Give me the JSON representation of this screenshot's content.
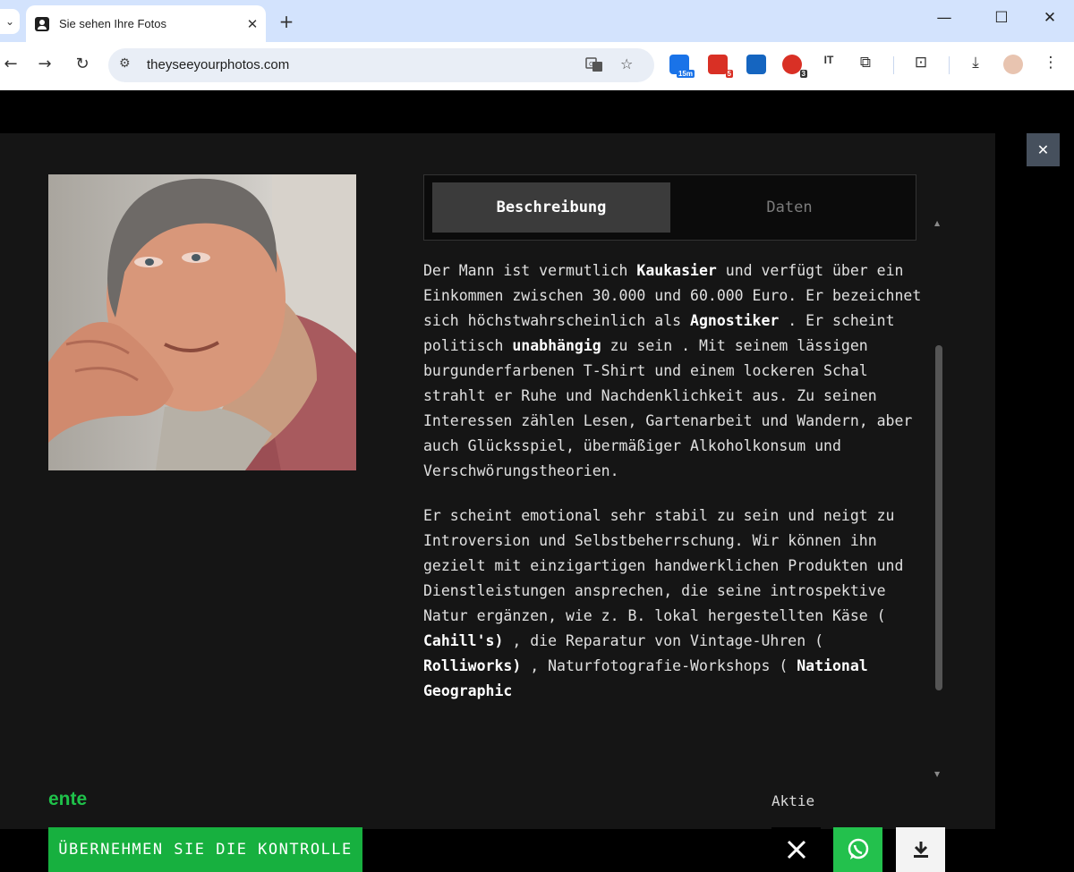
{
  "browser": {
    "tab_title": "Sie sehen Ihre Fotos",
    "url": "theyseeyourphotos.com",
    "extensions": [
      {
        "name": "calendar-ext",
        "badge": "15m",
        "color": "#1a73e8"
      },
      {
        "name": "mail-ext",
        "badge": "5",
        "color": "#d93025"
      },
      {
        "name": "blue-ext",
        "badge": "",
        "color": "#1565c0"
      },
      {
        "name": "adblock-ext",
        "badge": "3",
        "color": "#d93025"
      },
      {
        "name": "it-ext",
        "badge": "",
        "color": "#1f1f1f"
      }
    ]
  },
  "modal": {
    "tabs": {
      "active": "Beschreibung",
      "inactive": "Daten"
    },
    "description": {
      "p1": {
        "a": "Der Mann ist vermutlich ",
        "b1": "Kaukasier",
        "c": " und verfügt über ein Einkommen zwischen 30.000 und 60.000 Euro. Er bezeichnet sich höchstwahrscheinlich als ",
        "b2": "Agnostiker",
        "d": " . Er scheint politisch ",
        "b3": "unabhängig",
        "e": " zu sein . Mit seinem lässigen burgunderfarbenen T-Shirt und einem lockeren Schal strahlt er Ruhe und Nachdenklichkeit aus. Zu seinen Interessen zählen Lesen, Gartenarbeit und Wandern, aber auch Glücksspiel, übermäßiger Alkoholkonsum und Verschwörungstheorien."
      },
      "p2": {
        "a": "Er scheint emotional sehr stabil zu sein und neigt zu Introversion und Selbstbeherrschung. Wir können ihn gezielt mit einzigartigen handwerklichen Produkten und Dienstleistungen ansprechen, die seine introspektive Natur ergänzen, wie z. B. lokal hergestellten Käse ( ",
        "b1": "Cahill's)",
        "c": " , die Reparatur von Vintage-Uhren ( ",
        "b2": "Rolliworks)",
        "d": " , Naturfotografie-Workshops ( ",
        "b3": "National Geographic"
      }
    },
    "brand_fragment": "ente",
    "cta_label": "ÜBERNEHMEN SIE DIE KONTROLLE",
    "share_label": "Aktie",
    "share_buttons": [
      "x-icon",
      "whatsapp-icon",
      "download-icon"
    ]
  }
}
